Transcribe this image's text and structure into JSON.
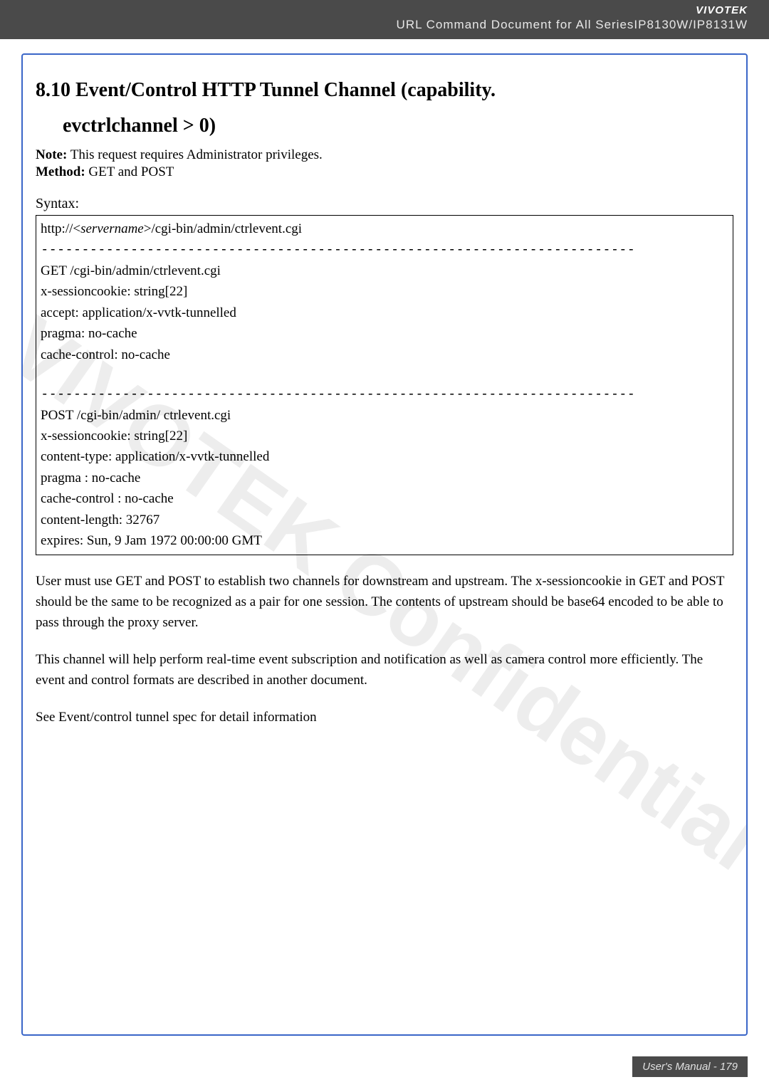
{
  "header": {
    "brand": "VIVOTEK",
    "title": "URL Command Document for All SeriesIP8130W/IP8131W"
  },
  "section": {
    "heading_line1": "8.10 Event/Control HTTP Tunnel Channel (capability.",
    "heading_line2": "evctrlchannel > 0)",
    "note_label": "Note:",
    "note_text": " This request requires Administrator privileges.",
    "method_label": "Method:",
    "method_text": " GET and POST"
  },
  "syntax": {
    "label": "Syntax:",
    "line_url_prefix": "http://<",
    "line_url_server": "servername",
    "line_url_suffix": ">/cgi-bin/admin/ctrlevent.cgi",
    "sep": "-------------------------------------------------------------------------",
    "get_block": [
      "GET /cgi-bin/admin/ctrlevent.cgi",
      "x-sessioncookie: string[22]",
      "accept: application/x-vvtk-tunnelled",
      "pragma: no-cache",
      "cache-control: no-cache"
    ],
    "post_block": [
      "POST /cgi-bin/admin/ ctrlevent.cgi",
      "x-sessioncookie: string[22]",
      "content-type: application/x-vvtk-tunnelled",
      "pragma : no-cache",
      "cache-control : no-cache",
      "content-length: 32767",
      "expires: Sun, 9 Jam 1972 00:00:00 GMT"
    ]
  },
  "body_paragraphs": {
    "p1": "User must use GET and POST to establish two channels for downstream and upstream. The x-sessioncookie in GET and POST should be the same to be recognized as a pair for one session. The contents of upstream should be base64 encoded to be able to pass through the proxy server.",
    "p2": "This channel will help perform real-time event subscription and notification as well as camera control more efficiently. The event and control formats are described in another document.",
    "p3": "See Event/control tunnel spec for detail information"
  },
  "footer": {
    "text": "User's Manual - 179"
  },
  "watermark": {
    "main": "VIVOTEK Confidential"
  }
}
